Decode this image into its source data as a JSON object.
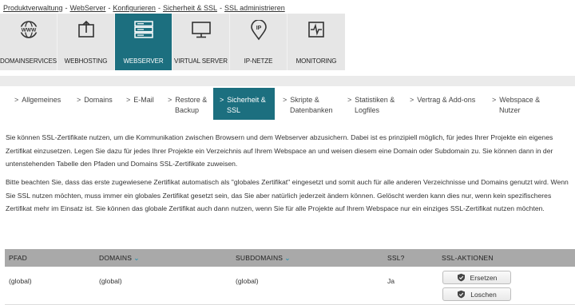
{
  "breadcrumb": [
    "Produktverwaltung",
    "WebServer",
    "Konfigurieren",
    "Sicherheit & SSL",
    "SSL administrieren"
  ],
  "breadcrumb_separator": "-",
  "topnav": [
    {
      "label": "DOMAINSERVICES",
      "icon": "www-globe-icon",
      "active": false
    },
    {
      "label": "WEBHOSTING",
      "icon": "upload-box-icon",
      "active": false
    },
    {
      "label": "WEBSERVER",
      "icon": "server-rack-icon",
      "active": true
    },
    {
      "label": "VIRTUAL SERVER",
      "icon": "monitor-icon",
      "active": false
    },
    {
      "label": "IP-NETZE",
      "icon": "ip-pin-icon",
      "active": false
    },
    {
      "label": "MONITORING",
      "icon": "pulse-icon",
      "active": false
    }
  ],
  "subnav": [
    {
      "line1": "Allgemeines",
      "line2": "",
      "active": false
    },
    {
      "line1": "Domains",
      "line2": "",
      "active": false
    },
    {
      "line1": "E-Mail",
      "line2": "",
      "active": false
    },
    {
      "line1": "Restore &",
      "line2": "Backup",
      "active": false
    },
    {
      "line1": "Sicherheit &",
      "line2": "SSL",
      "active": true
    },
    {
      "line1": "Skripte &",
      "line2": "Datenbanken",
      "active": false
    },
    {
      "line1": "Statistiken &",
      "line2": "Logfiles",
      "active": false
    },
    {
      "line1": "Vertrag & Add-ons",
      "line2": "",
      "active": false
    },
    {
      "line1": "Webspace &",
      "line2": "Nutzer",
      "active": false
    }
  ],
  "chevron": ">",
  "paragraphs": [
    "Sie können SSL-Zertifikate nutzen, um die Kommunikation zwischen Browsern und dem Webserver abzusichern. Dabei ist es prinzipiell möglich, für jedes Ihrer Projekte ein eigenes Zertifikat einzusetzen. Legen Sie dazu für jedes Ihrer Projekte ein Verzeichnis auf Ihrem Webspace an und weisen diesem eine Domain oder Subdomain zu. Sie können dann in der untenstehenden Tabelle den Pfaden und Domains SSL-Zertifikate zuweisen.",
    "Bitte beachten Sie, dass das erste zugewiesene Zertifikat automatisch als \"globales Zertifikat\" eingesetzt und somit auch für alle anderen Verzeichnisse und Domains genutzt wird. Wenn Sie SSL nutzen möchten, muss immer ein globales Zertifikat gesetzt sein, das Sie aber natürlich jederzeit ändern können. Gelöscht werden kann dies nur, wenn kein spezifischeres Zertifikat mehr im Einsatz ist. Sie können das globale Zertifikat auch dann nutzen, wenn Sie für alle Projekte auf Ihrem Webspace nur ein einziges SSL-Zertifikat nutzen möchten."
  ],
  "table": {
    "headers": {
      "pfad": "PFAD",
      "domains": "DOMAINS",
      "subdomains": "SUBDOMAINS",
      "ssl": "SSL?",
      "actions": "SSL-AKTIONEN"
    },
    "sort_icon": "chevron-down-icon",
    "rows": [
      {
        "pfad": "(global)",
        "domains": "(global)",
        "subdomains": "(global)",
        "ssl": "Ja"
      }
    ],
    "buttons": {
      "replace": "Ersetzen",
      "delete": "Loschen"
    }
  },
  "colors": {
    "accent": "#1c6f7f",
    "nav_bg": "#e6e6e6",
    "table_header": "#a9a9a9",
    "sort_icon": "#1a8fb0"
  }
}
